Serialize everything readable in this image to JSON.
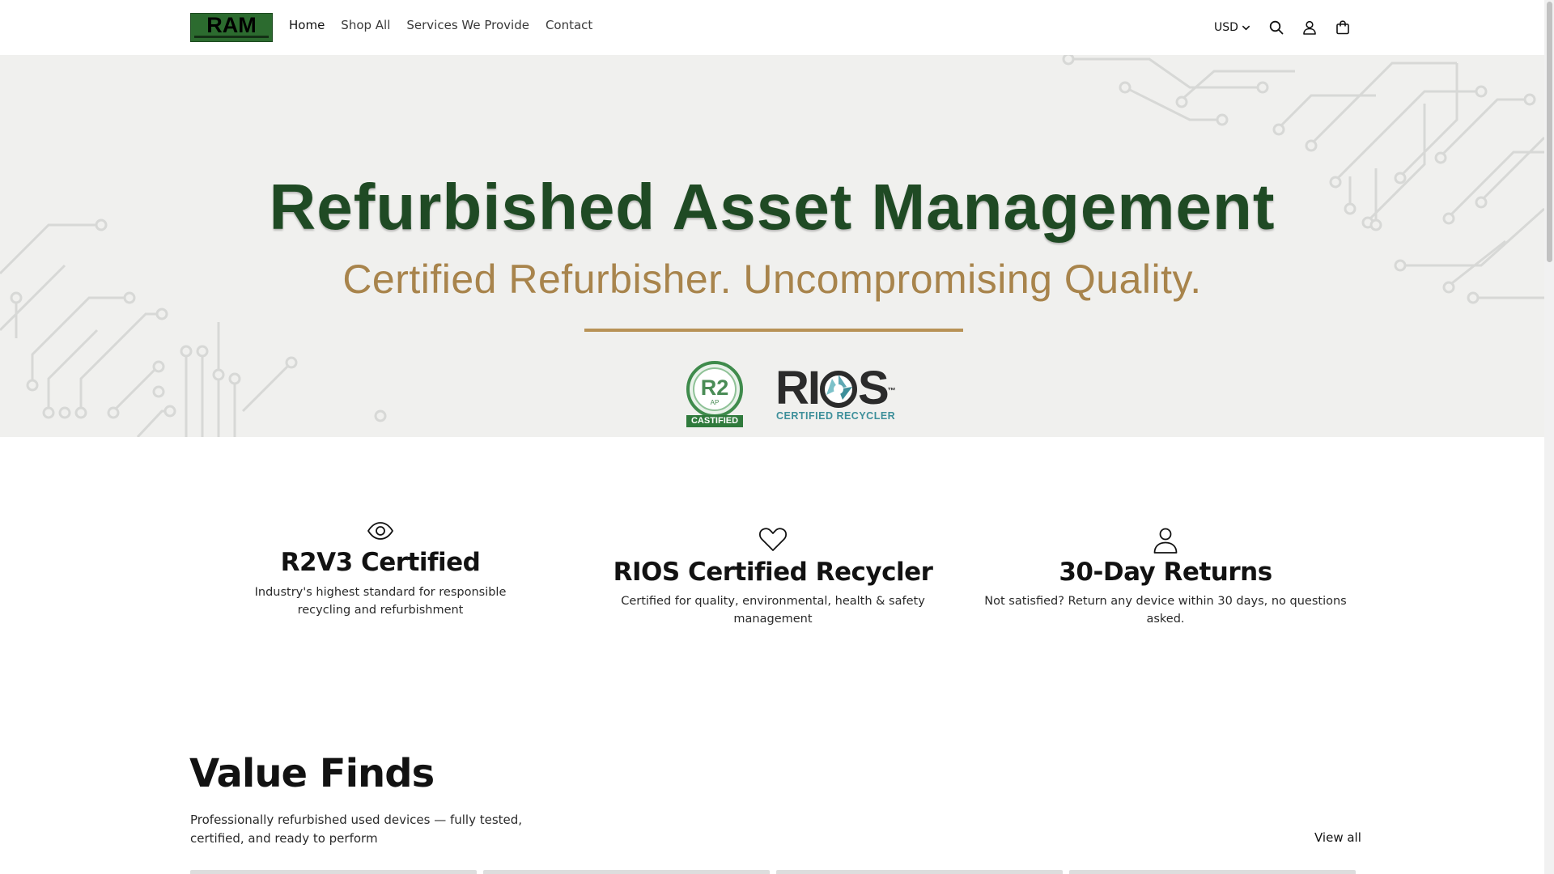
{
  "header": {
    "logo_text": "RAM",
    "nav": [
      "Home",
      "Shop All",
      "Services We Provide",
      "Contact"
    ],
    "currency": "USD",
    "icons": [
      "search-icon",
      "account-icon",
      "cart-icon"
    ]
  },
  "hero": {
    "title": "Refurbished Asset Management",
    "subtitle": "Certified Refurbisher. Uncompromising Quality.",
    "r2_badge": {
      "mark": "R2",
      "sub": "AP",
      "caption": "CASTIFIED"
    },
    "rios_logo": {
      "text_left": "RI",
      "text_right": "S",
      "tm": "™",
      "caption": "CERTIFIED RECYCLER"
    },
    "colors": {
      "title": "#1f4a24",
      "subtitle": "#a8844c",
      "rule": "#b89256",
      "background": "#f0f0ee"
    }
  },
  "features": [
    {
      "icon": "eye-icon",
      "title": "R2V3 Certified",
      "text": "Industry's highest standard for responsible recycling and refurbishment"
    },
    {
      "icon": "heart-icon",
      "title": "RIOS Certified Recycler",
      "text": "Certified for quality, environmental, health & safety management"
    },
    {
      "icon": "person-icon",
      "title": "30-Day Returns",
      "text": "Not satisfied? Return any device within 30 days, no questions asked."
    }
  ],
  "value_finds": {
    "title": "Value Finds",
    "description": "Professionally refurbished used devices — fully tested, certified, and ready to perform",
    "view_all": "View all"
  },
  "brand_color": "#2c6b2f"
}
